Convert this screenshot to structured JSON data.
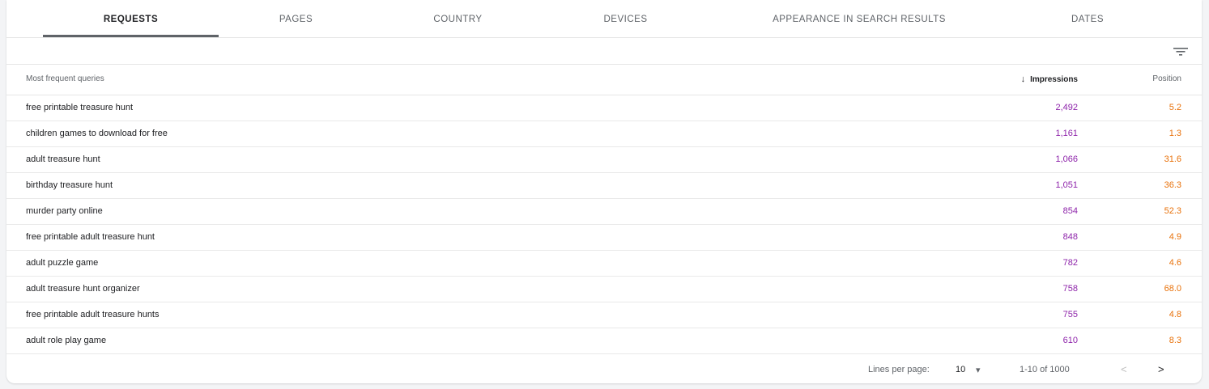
{
  "tabs": [
    {
      "label": "REQUESTS",
      "active": true
    },
    {
      "label": "PAGES",
      "active": false
    },
    {
      "label": "COUNTRY",
      "active": false
    },
    {
      "label": "DEVICES",
      "active": false
    },
    {
      "label": "APPEARANCE IN SEARCH RESULTS",
      "active": false
    },
    {
      "label": "DATES",
      "active": false
    }
  ],
  "toolbar": {
    "filter_icon": "filter-list-icon"
  },
  "table": {
    "headers": {
      "query": "Most frequent queries",
      "impressions": "Impressions",
      "position": "Position",
      "sort_icon": "arrow-down-icon",
      "sort_glyph": "↓"
    },
    "rows": [
      {
        "query": "free printable treasure hunt",
        "impressions": "2,492",
        "position": "5.2"
      },
      {
        "query": "children games to download for free",
        "impressions": "1,161",
        "position": "1.3"
      },
      {
        "query": "adult treasure hunt",
        "impressions": "1,066",
        "position": "31.6"
      },
      {
        "query": "birthday treasure hunt",
        "impressions": "1,051",
        "position": "36.3"
      },
      {
        "query": "murder party online",
        "impressions": "854",
        "position": "52.3"
      },
      {
        "query": "free printable adult treasure hunt",
        "impressions": "848",
        "position": "4.9"
      },
      {
        "query": "adult puzzle game",
        "impressions": "782",
        "position": "4.6"
      },
      {
        "query": "adult treasure hunt organizer",
        "impressions": "758",
        "position": "68.0"
      },
      {
        "query": "free printable adult treasure hunts",
        "impressions": "755",
        "position": "4.8"
      },
      {
        "query": "adult role play game",
        "impressions": "610",
        "position": "8.3"
      }
    ]
  },
  "pagination": {
    "lines_per_page_label": "Lines per page:",
    "lines_per_page_value": "10",
    "dropdown_glyph": "▾",
    "range_text": "1-10 of 1000",
    "prev_glyph": "<",
    "next_glyph": ">"
  },
  "colors": {
    "impressions": "#8e24aa",
    "position": "#e8710a",
    "active_tab_ink": "#5f6368"
  }
}
